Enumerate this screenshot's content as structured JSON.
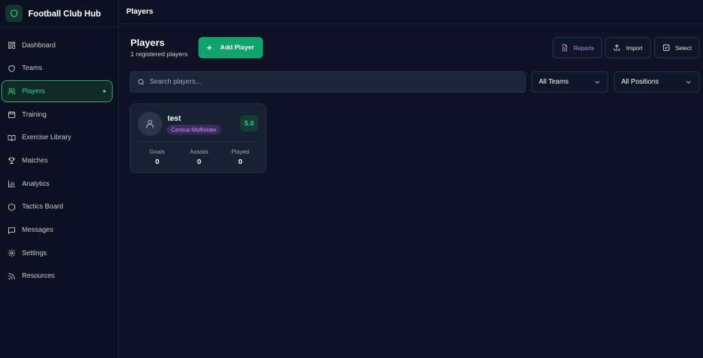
{
  "app": {
    "name": "Football Club Hub",
    "accent": "#2fd08f",
    "primary_button": "#10a36e"
  },
  "topbar": {
    "title": "Players"
  },
  "sidebar": {
    "items": [
      {
        "label": "Dashboard",
        "icon": "dashboard-grid-icon"
      },
      {
        "label": "Teams",
        "icon": "shield-icon"
      },
      {
        "label": "Players",
        "icon": "users-icon",
        "active": true
      },
      {
        "label": "Training",
        "icon": "calendar-icon"
      },
      {
        "label": "Exercise Library",
        "icon": "book-icon"
      },
      {
        "label": "Matches",
        "icon": "trophy-icon"
      },
      {
        "label": "Analytics",
        "icon": "bar-chart-icon"
      },
      {
        "label": "Tactics Board",
        "icon": "hexagon-icon"
      },
      {
        "label": "Messages",
        "icon": "message-icon"
      },
      {
        "label": "Settings",
        "icon": "gear-icon"
      },
      {
        "label": "Resources",
        "icon": "rss-icon"
      }
    ]
  },
  "page": {
    "title": "Players",
    "subtitle": "1 registered players",
    "add_button": "Add Player"
  },
  "toolbar": {
    "reports": "Reports",
    "import": "Import",
    "select": "Select"
  },
  "search": {
    "placeholder": "Search players..."
  },
  "filters": {
    "teams": "All Teams",
    "positions": "All Positions"
  },
  "players": [
    {
      "name": "test",
      "position": "Central Midfielder",
      "rating": "5.0",
      "stats": [
        {
          "label": "Goals",
          "value": "0"
        },
        {
          "label": "Assists",
          "value": "0"
        },
        {
          "label": "Played",
          "value": "0"
        }
      ]
    }
  ]
}
